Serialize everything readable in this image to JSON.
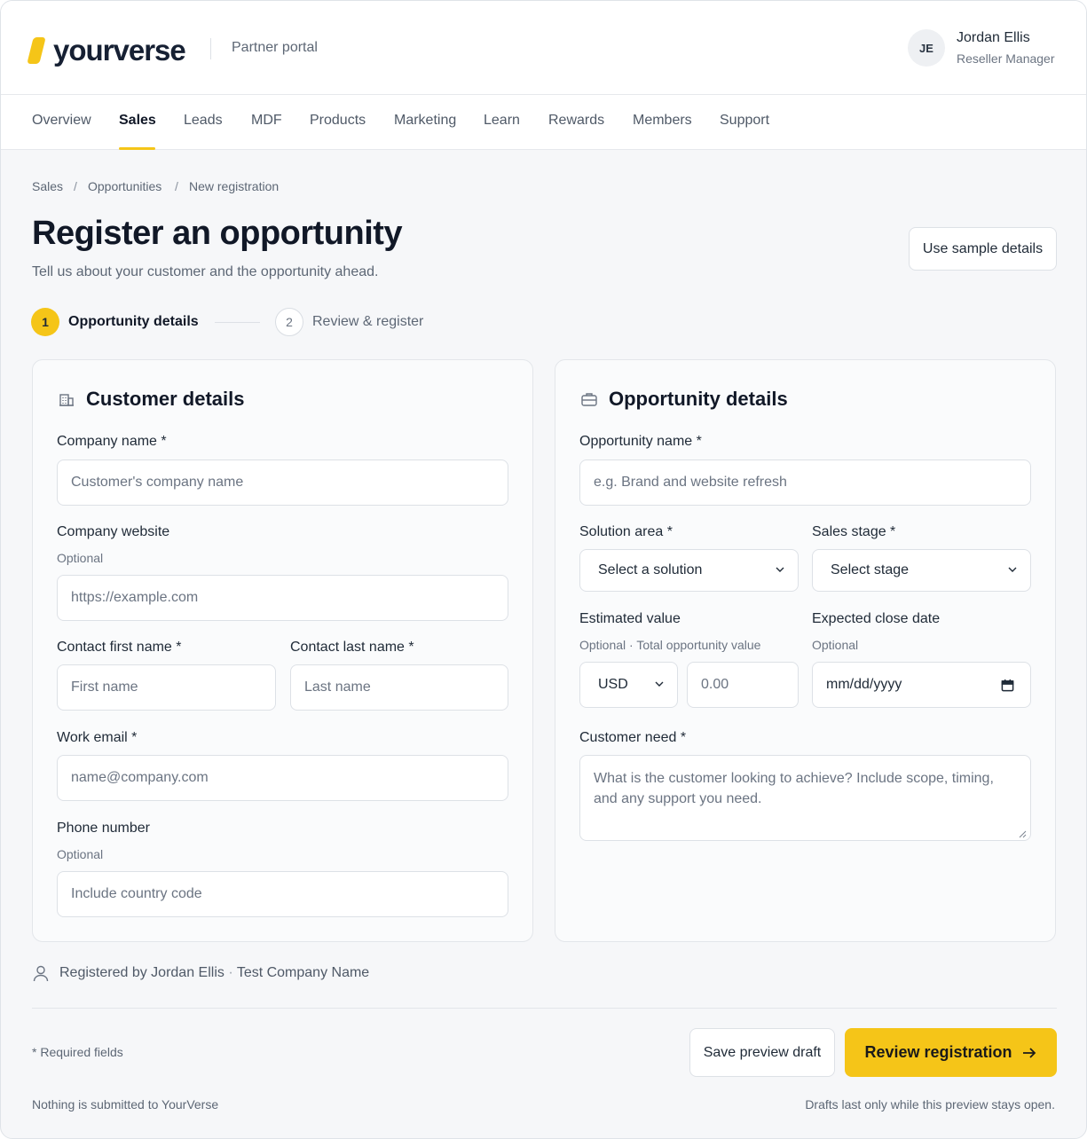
{
  "header": {
    "brand": "yourverse",
    "portal": "Partner portal",
    "user": {
      "initials": "JE",
      "name": "Jordan Ellis",
      "role": "Reseller Manager"
    }
  },
  "nav": {
    "items": [
      "Overview",
      "Sales",
      "Leads",
      "MDF",
      "Products",
      "Marketing",
      "Learn",
      "Rewards",
      "Members",
      "Support"
    ],
    "active": "Sales"
  },
  "breadcrumb": [
    "Sales",
    "Opportunities",
    "New registration"
  ],
  "page": {
    "title": "Register an opportunity",
    "subtitle": "Tell us about your customer and the opportunity ahead.",
    "sample_button": "Use sample details"
  },
  "steps": [
    {
      "num": "1",
      "label": "Opportunity details"
    },
    {
      "num": "2",
      "label": "Review & register"
    }
  ],
  "customer": {
    "title": "Customer details",
    "company_name": {
      "label": "Company name *",
      "placeholder": "Customer's company name"
    },
    "website": {
      "label": "Company website",
      "hint": "Optional",
      "placeholder": "https://example.com"
    },
    "first_name": {
      "label": "Contact first name *",
      "placeholder": "First name"
    },
    "last_name": {
      "label": "Contact last name *",
      "placeholder": "Last name"
    },
    "email": {
      "label": "Work email *",
      "placeholder": "name@company.com"
    },
    "phone": {
      "label": "Phone number",
      "hint": "Optional",
      "placeholder": "Include country code"
    }
  },
  "opportunity": {
    "title": "Opportunity details",
    "name": {
      "label": "Opportunity name *",
      "placeholder": "e.g. Brand and website refresh"
    },
    "solution": {
      "label": "Solution area *",
      "value": "Select a solution"
    },
    "stage": {
      "label": "Sales stage *",
      "value": "Select stage"
    },
    "value": {
      "label": "Estimated value",
      "hint": "Optional · Total opportunity value",
      "currency": "USD",
      "placeholder": "0.00"
    },
    "close_date": {
      "label": "Expected close date",
      "hint": "Optional",
      "placeholder": "mm/dd/yyyy"
    },
    "need": {
      "label": "Customer need *",
      "placeholder": "What is the customer looking to achieve? Include scope, timing, and any support you need."
    }
  },
  "footer": {
    "registered_by": "Registered by Jordan Ellis",
    "company": "Test Company Name",
    "required_note": "* Required fields",
    "draft_button": "Save preview draft",
    "review_button": "Review registration",
    "note_left": "Nothing is submitted to YourVerse",
    "note_right": "Drafts last only while this preview stays open."
  },
  "colors": {
    "accent": "#f5c518",
    "text": "#111827",
    "muted": "#5d6775"
  }
}
